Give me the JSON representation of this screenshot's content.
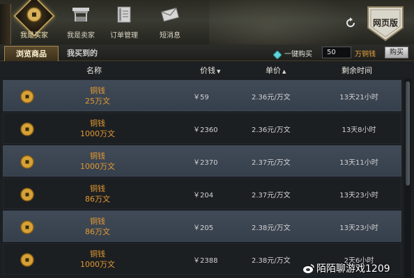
{
  "nav": {
    "tabs": [
      {
        "label": "我是买家",
        "icon": "coin-icon",
        "active": true
      },
      {
        "label": "我是卖家",
        "icon": "stall-icon",
        "active": false
      },
      {
        "label": "订单管理",
        "icon": "book-icon",
        "active": false
      },
      {
        "label": "短消息",
        "icon": "envelope-icon",
        "active": false
      }
    ],
    "refresh_icon": "refresh-icon",
    "web_version_label": "网页版"
  },
  "subtabs": [
    {
      "label": "浏览商品",
      "active": true
    },
    {
      "label": "我买到的",
      "active": false
    }
  ],
  "bulk_buy": {
    "label": "一键购买",
    "quantity": "50",
    "unit": "万铜钱",
    "button_label": "购买"
  },
  "columns": {
    "name": "名称",
    "price": "价钱",
    "unit_price": "单价",
    "remaining": "剩余时间"
  },
  "listings": [
    {
      "item": "铜钱",
      "amount": "25万文",
      "price": "￥59",
      "unit_price": "2.36元/万文",
      "remaining": "13天21小时"
    },
    {
      "item": "铜钱",
      "amount": "1000万文",
      "price": "￥2360",
      "unit_price": "2.36元/万文",
      "remaining": "13天8小时"
    },
    {
      "item": "铜钱",
      "amount": "1000万文",
      "price": "￥2370",
      "unit_price": "2.37元/万文",
      "remaining": "13天11小时"
    },
    {
      "item": "铜钱",
      "amount": "86万文",
      "price": "￥204",
      "unit_price": "2.37元/万文",
      "remaining": "13天23小时"
    },
    {
      "item": "铜钱",
      "amount": "86万文",
      "price": "￥205",
      "unit_price": "2.38元/万文",
      "remaining": "13天23小时"
    },
    {
      "item": "铜钱",
      "amount": "1000万文",
      "price": "￥2388",
      "unit_price": "2.38元/万文",
      "remaining": "2天6小时"
    }
  ],
  "watermark": "陌陌聊游戏1209",
  "colors": {
    "accent_gold": "#e39a32",
    "unit_orange": "#e8a23a",
    "row_highlight": "#3c4654"
  }
}
